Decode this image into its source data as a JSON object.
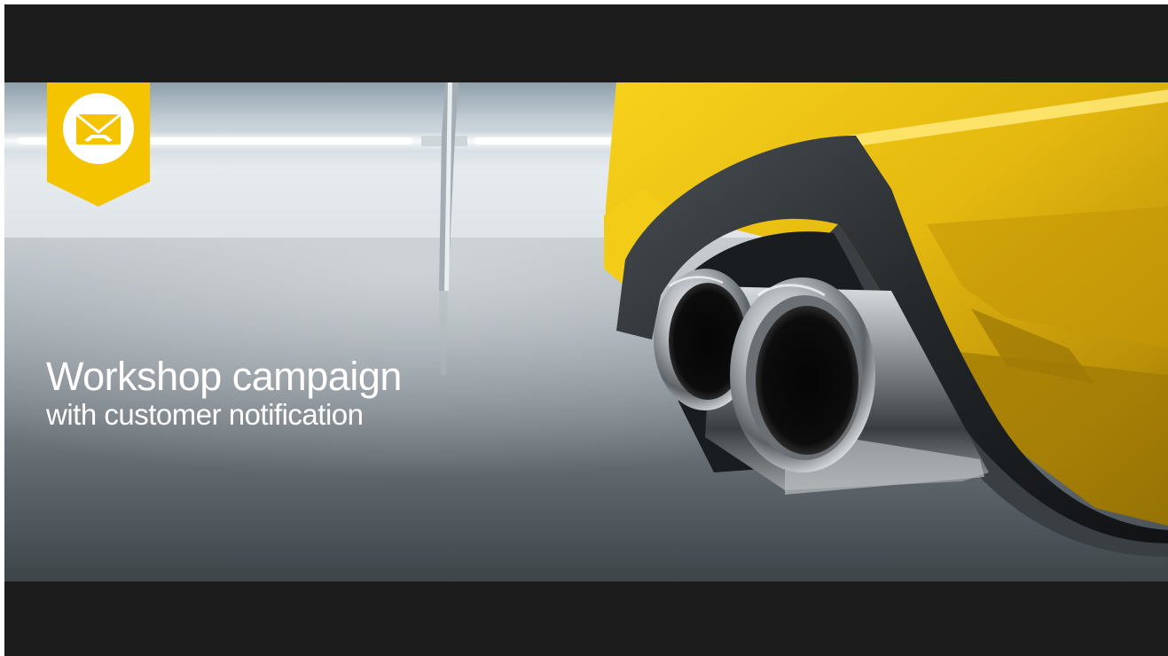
{
  "banner": {
    "title": "Workshop campaign",
    "subtitle": "with customer notification",
    "badge_icon": "envelope-wrench-icon",
    "accent_color": "#f5c400",
    "background_color": "#1c1c1c",
    "car_color": "#e8bb12"
  }
}
